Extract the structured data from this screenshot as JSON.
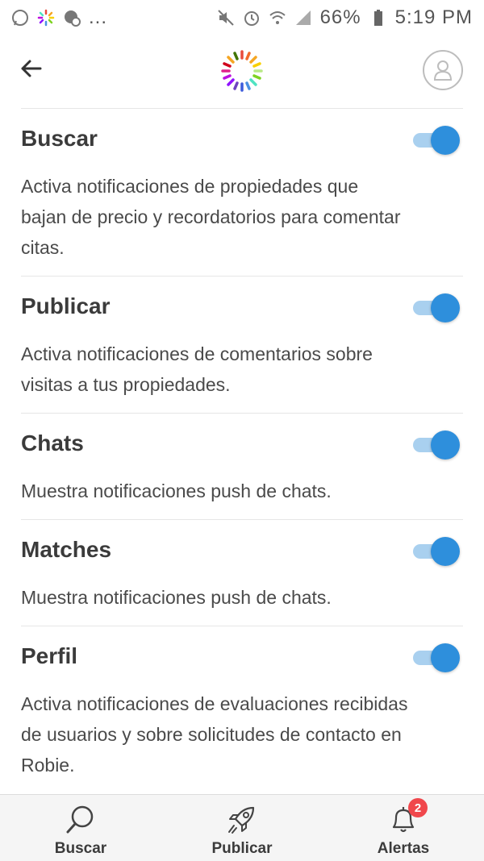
{
  "status_bar": {
    "left_overflow": "...",
    "battery": "66%",
    "time": "5:19 PM"
  },
  "header": {
    "back_icon": "arrow-left-icon",
    "logo_icon": "sunburst-logo-icon",
    "profile_icon": "user-icon"
  },
  "settings": [
    {
      "title": "Buscar",
      "description": "Activa notificaciones de propiedades que bajan de precio y recordatorios para comentar citas.",
      "enabled": true
    },
    {
      "title": "Publicar",
      "description": "Activa notificaciones de comentarios sobre visitas a tus propiedades.",
      "enabled": true
    },
    {
      "title": "Chats",
      "description": "Muestra notificaciones push de chats.",
      "enabled": true
    },
    {
      "title": "Matches",
      "description": "Muestra notificaciones push de chats.",
      "enabled": true
    },
    {
      "title": "Perfil",
      "description": "Activa notificaciones de evaluaciones recibidas de usuarios y sobre solicitudes de contacto en Robie.",
      "enabled": true
    }
  ],
  "bottom_nav": {
    "items": [
      {
        "label": "Buscar",
        "icon": "search-icon"
      },
      {
        "label": "Publicar",
        "icon": "rocket-icon"
      },
      {
        "label": "Alertas",
        "icon": "bell-icon",
        "badge": "2"
      }
    ]
  },
  "colors": {
    "toggle_on": "#2e8fdc",
    "toggle_track": "#a9d0ef",
    "badge": "#f0474c"
  }
}
